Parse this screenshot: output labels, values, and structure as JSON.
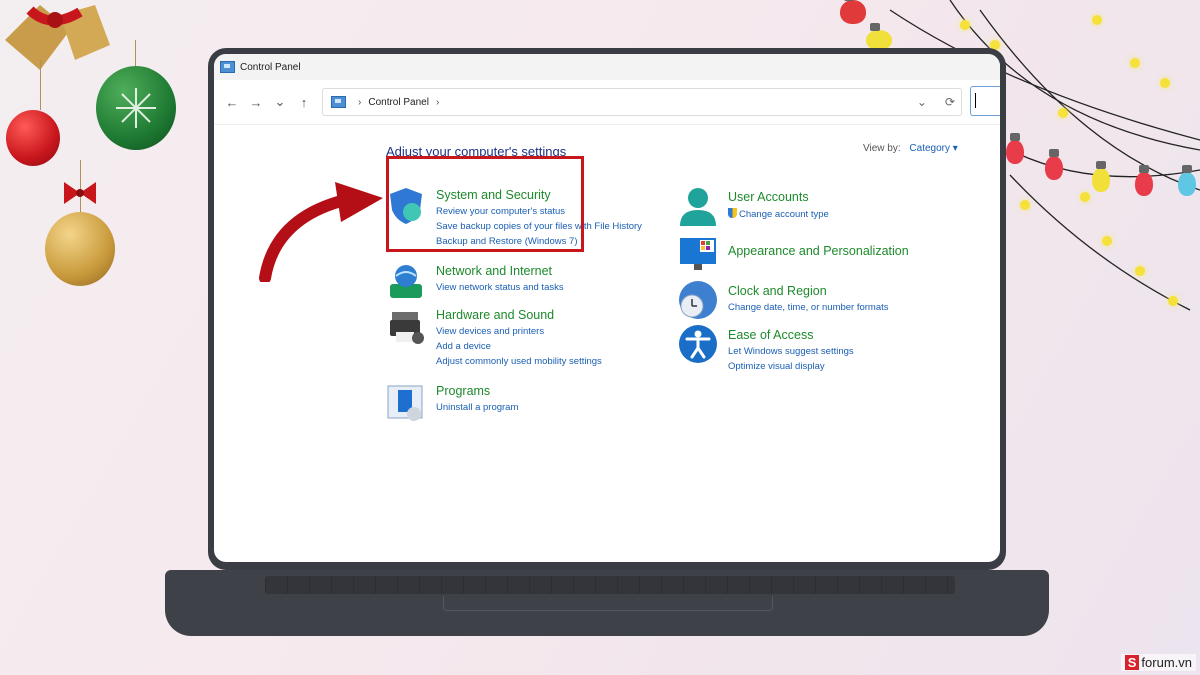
{
  "window": {
    "title": "Control Panel",
    "breadcrumb": "Control Panel"
  },
  "nav": {
    "back": "←",
    "forward": "→",
    "recent": "⌄",
    "up": "↑",
    "dropdown": "⌄",
    "refresh": "⟳",
    "sep": "›"
  },
  "main": {
    "heading": "Adjust your computer's settings",
    "view_by_label": "View by:",
    "view_by_value": "Category ▾",
    "categories": [
      {
        "title": "System and Security",
        "icon": "shield-icon",
        "links": [
          "Review your computer's status",
          "Save backup copies of your files with File History",
          "Backup and Restore (Windows 7)"
        ]
      },
      {
        "title": "Network and Internet",
        "icon": "network-icon",
        "links": [
          "View network status and tasks"
        ]
      },
      {
        "title": "Hardware and Sound",
        "icon": "printer-icon",
        "links": [
          "View devices and printers",
          "Add a device",
          "Adjust commonly used mobility settings"
        ]
      },
      {
        "title": "Programs",
        "icon": "programs-icon",
        "links": [
          "Uninstall a program"
        ]
      },
      {
        "title": "User Accounts",
        "icon": "user-icon",
        "links": [
          "Change account type"
        ]
      },
      {
        "title": "Appearance and Personalization",
        "icon": "monitor-icon",
        "links": []
      },
      {
        "title": "Clock and Region",
        "icon": "clock-icon",
        "links": [
          "Change date, time, or number formats"
        ]
      },
      {
        "title": "Ease of Access",
        "icon": "accessibility-icon",
        "links": [
          "Let Windows suggest settings",
          "Optimize visual display"
        ]
      }
    ]
  },
  "watermark": {
    "logo": "S",
    "text": "forum.vn"
  },
  "colors": {
    "category_title": "#1d8a2c",
    "link": "#1a5fb4",
    "highlight": "#c8161d"
  }
}
